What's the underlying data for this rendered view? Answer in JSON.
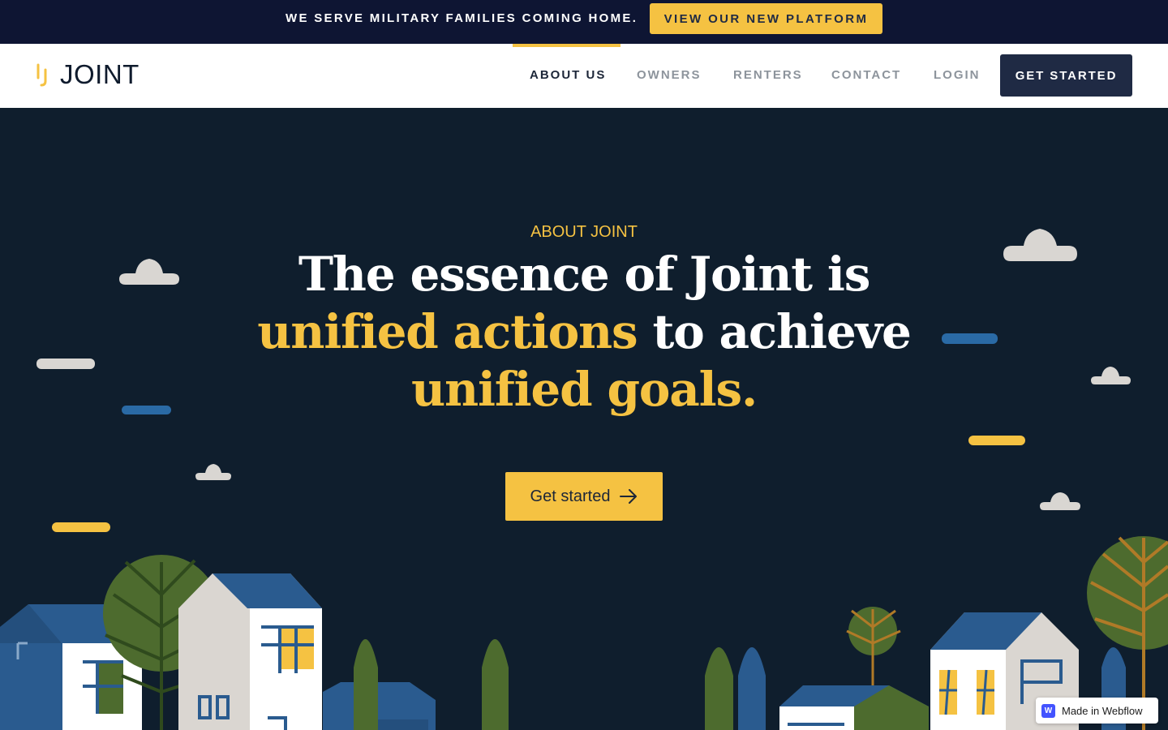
{
  "announcement": {
    "text": "WE SERVE MILITARY FAMILIES COMING HOME.",
    "button_label": "VIEW OUR NEW PLATFORM"
  },
  "nav": {
    "logo_text": "JOINT",
    "items": [
      {
        "label": "ABOUT US",
        "active": true
      },
      {
        "label": "OWNERS",
        "active": false
      },
      {
        "label": "RENTERS",
        "active": false
      },
      {
        "label": "CONTACT",
        "active": false
      },
      {
        "label": "LOGIN",
        "active": false
      }
    ],
    "cta_label": "GET STARTED"
  },
  "hero": {
    "eyebrow": "ABOUT JOINT",
    "title_line1": "The essence of Joint is",
    "title_hl1": "unified actions",
    "title_mid": " to achieve",
    "title_hl2": "unified goals.",
    "cta_label": "Get started",
    "cta_icon": "arrow-right-icon"
  },
  "badge": {
    "icon": "webflow-logo-icon",
    "text": "Made in Webflow"
  },
  "colors": {
    "announcement_bg": "#0e1533",
    "accent": "#f5c242",
    "hero_bg": "#0f1e2d",
    "nav_cta_bg": "#1f2a44",
    "house_blue": "#2a5b8f",
    "tree_green": "#4d6b2e"
  }
}
